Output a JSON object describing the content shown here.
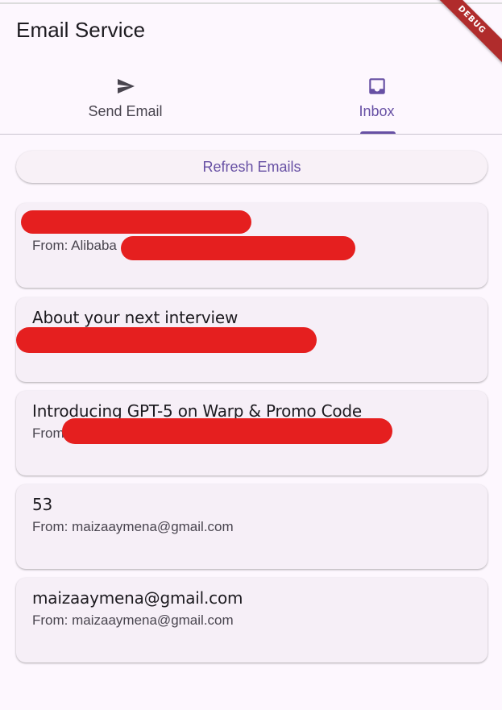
{
  "app": {
    "title": "Email Service",
    "debug_label": "DEBUG"
  },
  "tabs": [
    {
      "label": "Send Email",
      "icon": "send-icon",
      "selected": false
    },
    {
      "label": "Inbox",
      "icon": "inbox-icon",
      "selected": true
    }
  ],
  "actions": {
    "refresh_label": "Refresh Emails"
  },
  "emails": [
    {
      "subject": "",
      "from": "From: Alibaba",
      "redacted": true
    },
    {
      "subject": "About your next interview",
      "from": "",
      "redacted": true
    },
    {
      "subject": "Introducing GPT-5 on Warp & Promo Code",
      "from": "From",
      "redacted": true
    },
    {
      "subject": "53",
      "from": "From: maizaaymena@gmail.com",
      "redacted": false
    },
    {
      "subject": "maizaaymena@gmail.com",
      "from": "From: maizaaymena@gmail.com",
      "redacted": false
    }
  ],
  "colors": {
    "accent": "#6750a4",
    "background": "#fdf7fe",
    "card": "#f6eff7",
    "redaction": "#e51f1f",
    "debug_banner": "#b02c2c"
  }
}
